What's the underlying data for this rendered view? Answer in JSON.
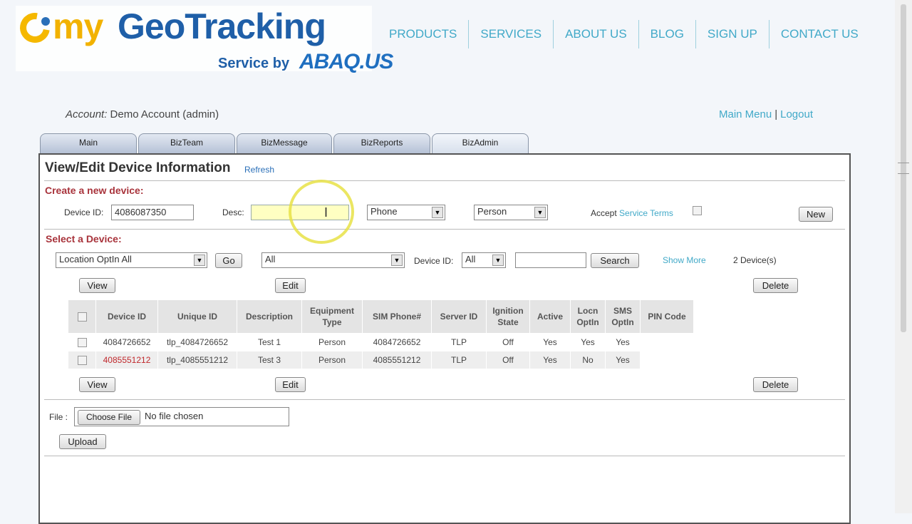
{
  "logo": {
    "my": "my",
    "geo_tracking": "GeoTracking",
    "service_by": "Service by",
    "brand": "ABAQ.US"
  },
  "nav": [
    "PRODUCTS",
    "SERVICES",
    "ABOUT US",
    "BLOG",
    "SIGN UP",
    "CONTACT US"
  ],
  "account": {
    "label": "Account:",
    "value": "Demo Account (admin)"
  },
  "topright": {
    "main_menu": "Main Menu",
    "sep": "|",
    "logout": "Logout"
  },
  "tabs": [
    "Main",
    "BizTeam",
    "BizMessage",
    "BizReports",
    "BizAdmin"
  ],
  "page": {
    "title": "View/Edit Device Information",
    "refresh": "Refresh"
  },
  "create": {
    "section": "Create a new device:",
    "device_id_label": "Device ID:",
    "device_id_value": "4086087350",
    "desc_label": "Desc:",
    "desc_value": "",
    "phone_select": "Phone",
    "person_select": "Person",
    "accept_label": "Accept",
    "service_terms": "Service Terms",
    "new_button": "New"
  },
  "select": {
    "section": "Select a Device:",
    "filter_select": "Location OptIn All",
    "go_button": "Go",
    "group_select": "All",
    "device_id_label": "Device ID:",
    "device_id_select": "All",
    "search_value": "",
    "search_button": "Search",
    "show_more": "Show More",
    "count": "2 Device(s)"
  },
  "actions": {
    "view": "View",
    "edit": "Edit",
    "delete": "Delete"
  },
  "table": {
    "headers": [
      "Device ID",
      "Unique ID",
      "Description",
      "Equipment Type",
      "SIM Phone#",
      "Server ID",
      "Ignition State",
      "Active",
      "Locn OptIn",
      "SMS OptIn",
      "PIN Code"
    ],
    "rows": [
      [
        "4084726652",
        "tlp_4084726652",
        "Test 1",
        "Person",
        "4084726652",
        "TLP",
        "Off",
        "Yes",
        "Yes",
        "Yes",
        ""
      ],
      [
        "4085551212",
        "tlp_4085551212",
        "Test 3",
        "Person",
        "4085551212",
        "TLP",
        "Off",
        "Yes",
        "No",
        "Yes",
        ""
      ]
    ]
  },
  "upload": {
    "file_label": "File :",
    "choose_button": "Choose File",
    "no_file": "No file chosen",
    "upload_button": "Upload"
  },
  "colors": {
    "accent": "#41a9c8",
    "brand_blue": "#1f5fa8",
    "brand_yellow": "#f2b200",
    "section_red": "#a8333b"
  }
}
